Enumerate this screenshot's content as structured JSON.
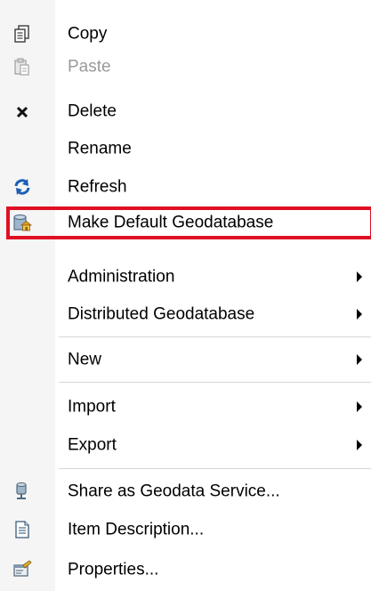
{
  "menu": {
    "items": [
      {
        "label": "Copy",
        "icon": "copy-icon",
        "enabled": true
      },
      {
        "label": "Paste",
        "icon": "paste-icon",
        "enabled": false
      },
      {
        "label": "Delete",
        "icon": "delete-x-icon",
        "enabled": true
      },
      {
        "label": "Rename",
        "icon": "",
        "enabled": true
      },
      {
        "label": "Refresh",
        "icon": "refresh-icon",
        "enabled": true
      },
      {
        "label": "Make Default Geodatabase",
        "icon": "geodatabase-home-icon",
        "enabled": true,
        "highlighted": true
      },
      {
        "label": "Administration",
        "icon": "",
        "enabled": true,
        "submenu": true
      },
      {
        "label": "Distributed Geodatabase",
        "icon": "",
        "enabled": true,
        "submenu": true
      },
      {
        "label": "New",
        "icon": "",
        "enabled": true,
        "submenu": true
      },
      {
        "label": "Import",
        "icon": "",
        "enabled": true,
        "submenu": true
      },
      {
        "label": "Export",
        "icon": "",
        "enabled": true,
        "submenu": true
      },
      {
        "label": "Share as Geodata Service...",
        "icon": "geodata-service-icon",
        "enabled": true
      },
      {
        "label": "Item Description...",
        "icon": "item-description-icon",
        "enabled": true
      },
      {
        "label": "Properties...",
        "icon": "properties-icon",
        "enabled": true
      }
    ]
  },
  "colors": {
    "highlight_border": "#e01024",
    "disabled_text": "#9a9a9a",
    "gutter": "#f5f5f5"
  }
}
